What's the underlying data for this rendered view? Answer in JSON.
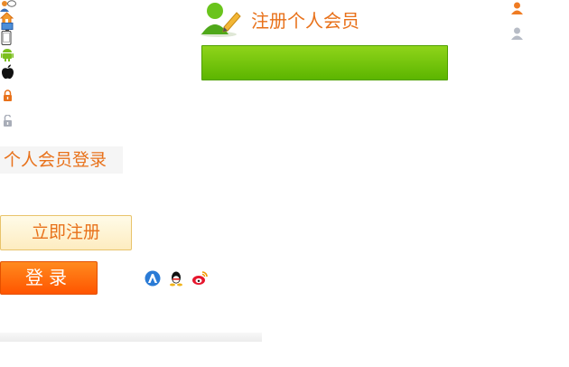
{
  "register": {
    "title": "注册个人会员"
  },
  "login": {
    "heading": "个人会员登录",
    "register_button": "立即注册",
    "login_button": "登录"
  },
  "icons": [
    "person-chat-icon",
    "home-icon",
    "monitor-icon",
    "phone-icon",
    "android-icon",
    "apple-icon",
    "lock-orange-icon",
    "lock-gray-icon",
    "user-orange-icon",
    "user-gray-icon",
    "baidu-icon",
    "qq-icon",
    "weibo-icon",
    "add-member-icon"
  ],
  "colors": {
    "accent_orange": "#e8711a",
    "button_orange": "#ff6a00",
    "green": "#6cc30a"
  }
}
